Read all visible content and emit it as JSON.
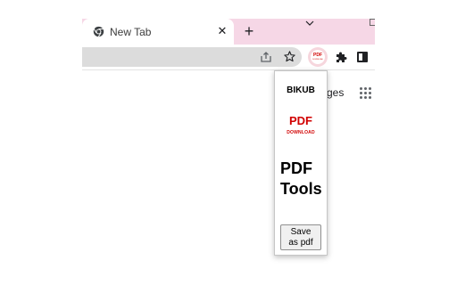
{
  "browser": {
    "tab": {
      "title": "New Tab",
      "favicon": "chrome-icon",
      "close_icon": "close-icon"
    },
    "new_tab_symbol": "+",
    "tab_search_icon": "chevron-down-icon",
    "toolbar": {
      "icons": [
        "share-icon",
        "star-icon",
        "pdf-extension-icon",
        "puzzle-icon",
        "side-panel-icon"
      ],
      "extension_button": {
        "label": "PDF",
        "sublabel": "DOWNLOAD"
      }
    },
    "accent_color": "#f6d7e6"
  },
  "new_tab_page": {
    "images_link": "ges",
    "apps_icon": "apps-grid-icon"
  },
  "popup": {
    "brand": "BIKUB",
    "logo": {
      "text": "PDF",
      "subtext": "DOWNLOAD",
      "color": "#d10000"
    },
    "title_line1": "PDF",
    "title_line2": "Tools",
    "save_button": {
      "line1": "Save",
      "line2": "as pdf"
    }
  }
}
